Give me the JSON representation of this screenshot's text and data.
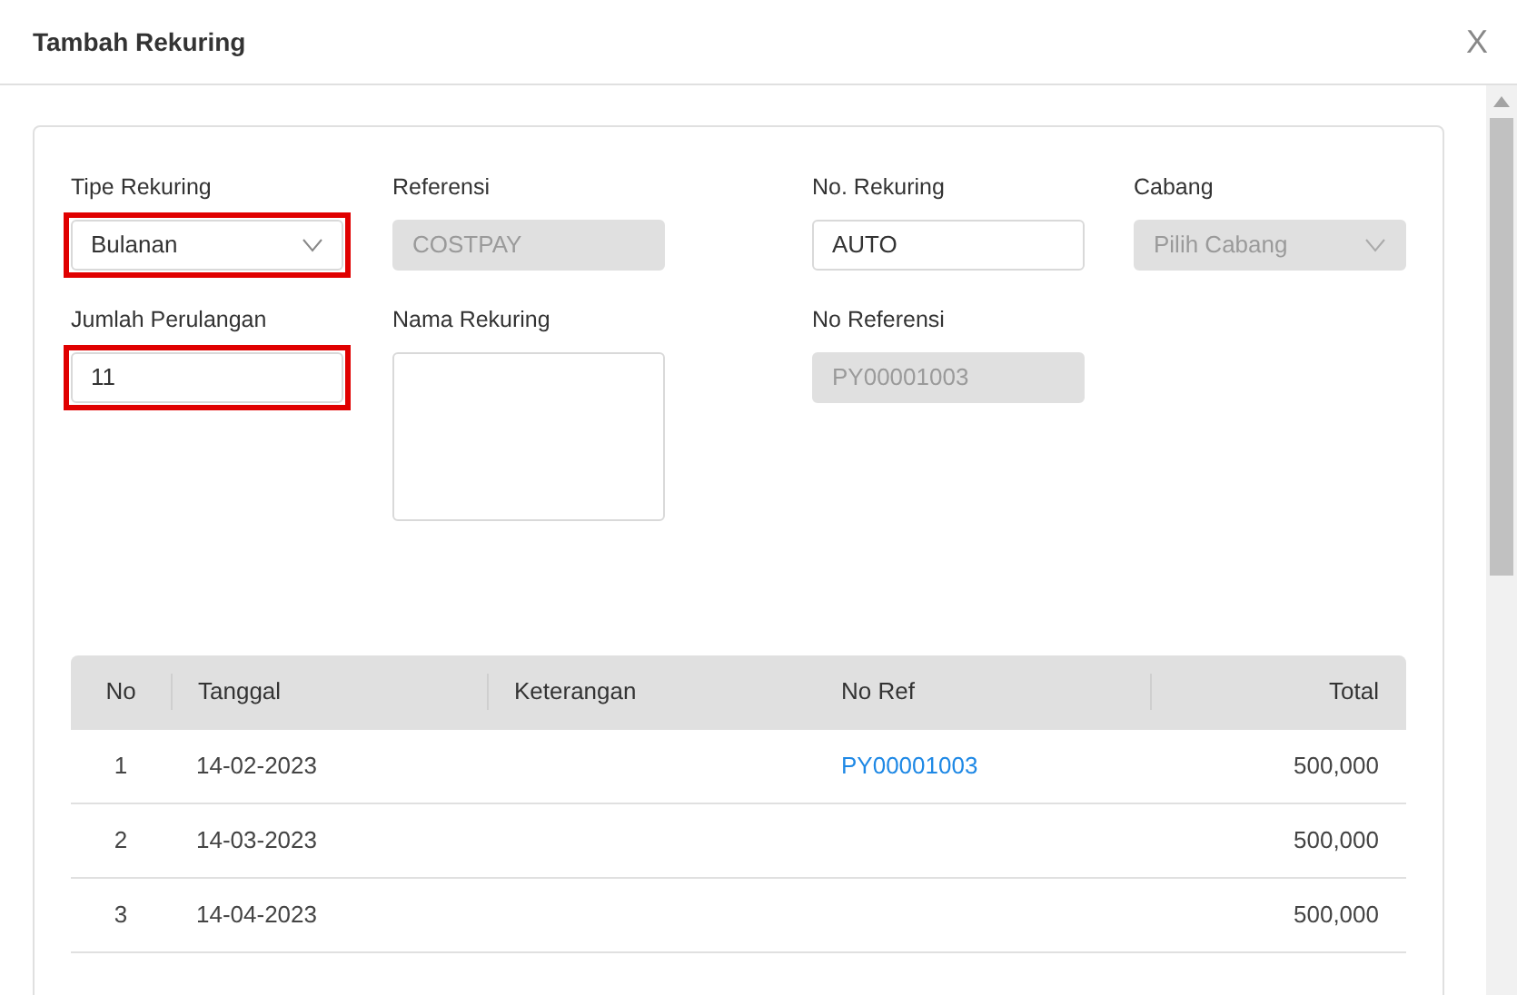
{
  "dialog": {
    "title": "Tambah Rekuring",
    "close": "X"
  },
  "fields": [
    {
      "label": "Tipe Rekuring",
      "kind": "select",
      "value": "Bulanan",
      "disabled": false,
      "highlighted": true
    },
    {
      "label": "Referensi",
      "kind": "input",
      "value": "COSTPAY",
      "disabled": true,
      "highlighted": false
    },
    {
      "label": "No. Rekuring",
      "kind": "input",
      "value": "AUTO",
      "disabled": false,
      "highlighted": false
    },
    {
      "label": "Cabang",
      "kind": "select",
      "placeholder": "Pilih Cabang",
      "disabled": true,
      "highlighted": false
    },
    {
      "label": "Jumlah Perulangan",
      "kind": "input",
      "value": "11",
      "disabled": false,
      "highlighted": true
    },
    {
      "label": "Nama Rekuring",
      "kind": "textarea",
      "disabled": false,
      "highlighted": false
    },
    {
      "label": "No Referensi",
      "kind": "input",
      "value": "PY00001003",
      "disabled": true,
      "highlighted": false
    }
  ],
  "table": {
    "columns": [
      "No",
      "Tanggal",
      "Keterangan",
      "No Ref",
      "Total"
    ],
    "rows": [
      {
        "no": "1",
        "tanggal": "14-02-2023",
        "no_ref": "PY00001003",
        "total": "500,000"
      },
      {
        "no": "2",
        "tanggal": "14-03-2023",
        "total": "500,000"
      },
      {
        "no": "3",
        "tanggal": "14-04-2023",
        "total": "500,000"
      }
    ]
  }
}
